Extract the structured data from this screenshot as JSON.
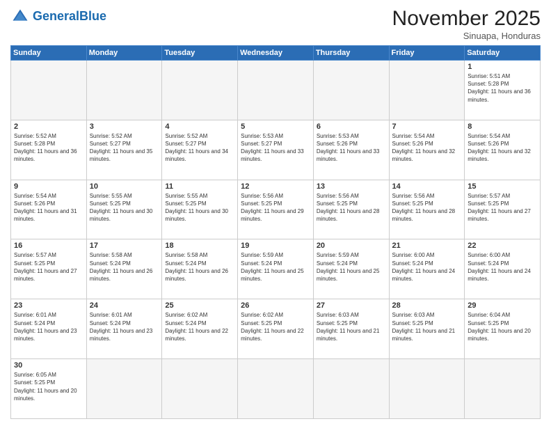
{
  "header": {
    "logo_general": "General",
    "logo_blue": "Blue",
    "month_title": "November 2025",
    "subtitle": "Sinuapa, Honduras"
  },
  "weekdays": [
    "Sunday",
    "Monday",
    "Tuesday",
    "Wednesday",
    "Thursday",
    "Friday",
    "Saturday"
  ],
  "days": [
    {
      "num": "",
      "sunrise": "",
      "sunset": "",
      "daylight": "",
      "empty": true
    },
    {
      "num": "",
      "sunrise": "",
      "sunset": "",
      "daylight": "",
      "empty": true
    },
    {
      "num": "",
      "sunrise": "",
      "sunset": "",
      "daylight": "",
      "empty": true
    },
    {
      "num": "",
      "sunrise": "",
      "sunset": "",
      "daylight": "",
      "empty": true
    },
    {
      "num": "",
      "sunrise": "",
      "sunset": "",
      "daylight": "",
      "empty": true
    },
    {
      "num": "",
      "sunrise": "",
      "sunset": "",
      "daylight": "",
      "empty": true
    },
    {
      "num": "1",
      "sunrise": "Sunrise: 5:51 AM",
      "sunset": "Sunset: 5:28 PM",
      "daylight": "Daylight: 11 hours and 36 minutes.",
      "empty": false
    },
    {
      "num": "2",
      "sunrise": "Sunrise: 5:52 AM",
      "sunset": "Sunset: 5:28 PM",
      "daylight": "Daylight: 11 hours and 36 minutes.",
      "empty": false
    },
    {
      "num": "3",
      "sunrise": "Sunrise: 5:52 AM",
      "sunset": "Sunset: 5:27 PM",
      "daylight": "Daylight: 11 hours and 35 minutes.",
      "empty": false
    },
    {
      "num": "4",
      "sunrise": "Sunrise: 5:52 AM",
      "sunset": "Sunset: 5:27 PM",
      "daylight": "Daylight: 11 hours and 34 minutes.",
      "empty": false
    },
    {
      "num": "5",
      "sunrise": "Sunrise: 5:53 AM",
      "sunset": "Sunset: 5:27 PM",
      "daylight": "Daylight: 11 hours and 33 minutes.",
      "empty": false
    },
    {
      "num": "6",
      "sunrise": "Sunrise: 5:53 AM",
      "sunset": "Sunset: 5:26 PM",
      "daylight": "Daylight: 11 hours and 33 minutes.",
      "empty": false
    },
    {
      "num": "7",
      "sunrise": "Sunrise: 5:54 AM",
      "sunset": "Sunset: 5:26 PM",
      "daylight": "Daylight: 11 hours and 32 minutes.",
      "empty": false
    },
    {
      "num": "8",
      "sunrise": "Sunrise: 5:54 AM",
      "sunset": "Sunset: 5:26 PM",
      "daylight": "Daylight: 11 hours and 32 minutes.",
      "empty": false
    },
    {
      "num": "9",
      "sunrise": "Sunrise: 5:54 AM",
      "sunset": "Sunset: 5:26 PM",
      "daylight": "Daylight: 11 hours and 31 minutes.",
      "empty": false
    },
    {
      "num": "10",
      "sunrise": "Sunrise: 5:55 AM",
      "sunset": "Sunset: 5:25 PM",
      "daylight": "Daylight: 11 hours and 30 minutes.",
      "empty": false
    },
    {
      "num": "11",
      "sunrise": "Sunrise: 5:55 AM",
      "sunset": "Sunset: 5:25 PM",
      "daylight": "Daylight: 11 hours and 30 minutes.",
      "empty": false
    },
    {
      "num": "12",
      "sunrise": "Sunrise: 5:56 AM",
      "sunset": "Sunset: 5:25 PM",
      "daylight": "Daylight: 11 hours and 29 minutes.",
      "empty": false
    },
    {
      "num": "13",
      "sunrise": "Sunrise: 5:56 AM",
      "sunset": "Sunset: 5:25 PM",
      "daylight": "Daylight: 11 hours and 28 minutes.",
      "empty": false
    },
    {
      "num": "14",
      "sunrise": "Sunrise: 5:56 AM",
      "sunset": "Sunset: 5:25 PM",
      "daylight": "Daylight: 11 hours and 28 minutes.",
      "empty": false
    },
    {
      "num": "15",
      "sunrise": "Sunrise: 5:57 AM",
      "sunset": "Sunset: 5:25 PM",
      "daylight": "Daylight: 11 hours and 27 minutes.",
      "empty": false
    },
    {
      "num": "16",
      "sunrise": "Sunrise: 5:57 AM",
      "sunset": "Sunset: 5:25 PM",
      "daylight": "Daylight: 11 hours and 27 minutes.",
      "empty": false
    },
    {
      "num": "17",
      "sunrise": "Sunrise: 5:58 AM",
      "sunset": "Sunset: 5:24 PM",
      "daylight": "Daylight: 11 hours and 26 minutes.",
      "empty": false
    },
    {
      "num": "18",
      "sunrise": "Sunrise: 5:58 AM",
      "sunset": "Sunset: 5:24 PM",
      "daylight": "Daylight: 11 hours and 26 minutes.",
      "empty": false
    },
    {
      "num": "19",
      "sunrise": "Sunrise: 5:59 AM",
      "sunset": "Sunset: 5:24 PM",
      "daylight": "Daylight: 11 hours and 25 minutes.",
      "empty": false
    },
    {
      "num": "20",
      "sunrise": "Sunrise: 5:59 AM",
      "sunset": "Sunset: 5:24 PM",
      "daylight": "Daylight: 11 hours and 25 minutes.",
      "empty": false
    },
    {
      "num": "21",
      "sunrise": "Sunrise: 6:00 AM",
      "sunset": "Sunset: 5:24 PM",
      "daylight": "Daylight: 11 hours and 24 minutes.",
      "empty": false
    },
    {
      "num": "22",
      "sunrise": "Sunrise: 6:00 AM",
      "sunset": "Sunset: 5:24 PM",
      "daylight": "Daylight: 11 hours and 24 minutes.",
      "empty": false
    },
    {
      "num": "23",
      "sunrise": "Sunrise: 6:01 AM",
      "sunset": "Sunset: 5:24 PM",
      "daylight": "Daylight: 11 hours and 23 minutes.",
      "empty": false
    },
    {
      "num": "24",
      "sunrise": "Sunrise: 6:01 AM",
      "sunset": "Sunset: 5:24 PM",
      "daylight": "Daylight: 11 hours and 23 minutes.",
      "empty": false
    },
    {
      "num": "25",
      "sunrise": "Sunrise: 6:02 AM",
      "sunset": "Sunset: 5:24 PM",
      "daylight": "Daylight: 11 hours and 22 minutes.",
      "empty": false
    },
    {
      "num": "26",
      "sunrise": "Sunrise: 6:02 AM",
      "sunset": "Sunset: 5:25 PM",
      "daylight": "Daylight: 11 hours and 22 minutes.",
      "empty": false
    },
    {
      "num": "27",
      "sunrise": "Sunrise: 6:03 AM",
      "sunset": "Sunset: 5:25 PM",
      "daylight": "Daylight: 11 hours and 21 minutes.",
      "empty": false
    },
    {
      "num": "28",
      "sunrise": "Sunrise: 6:03 AM",
      "sunset": "Sunset: 5:25 PM",
      "daylight": "Daylight: 11 hours and 21 minutes.",
      "empty": false
    },
    {
      "num": "29",
      "sunrise": "Sunrise: 6:04 AM",
      "sunset": "Sunset: 5:25 PM",
      "daylight": "Daylight: 11 hours and 20 minutes.",
      "empty": false
    },
    {
      "num": "30",
      "sunrise": "Sunrise: 6:05 AM",
      "sunset": "Sunset: 5:25 PM",
      "daylight": "Daylight: 11 hours and 20 minutes.",
      "empty": false
    }
  ]
}
